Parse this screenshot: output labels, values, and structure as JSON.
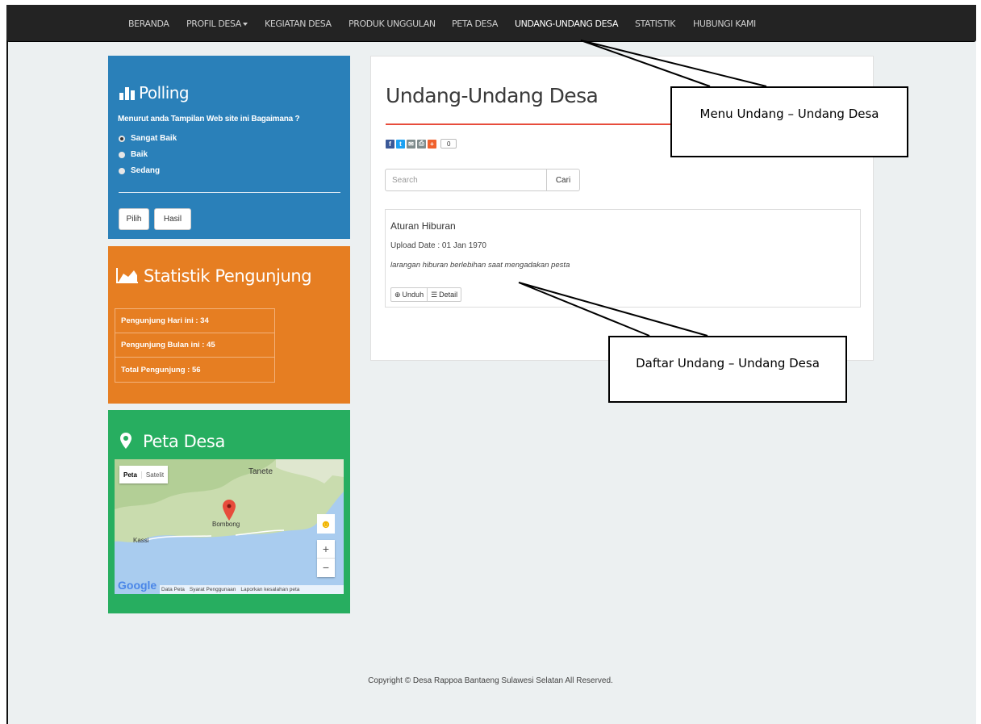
{
  "nav": {
    "items": [
      "BERANDA",
      "PROFIL DESA",
      "KEGIATAN DESA",
      "PRODUK UNGGULAN",
      "PETA DESA",
      "UNDANG-UNDANG DESA",
      "STATISTIK",
      "HUBUNGI KAMI"
    ]
  },
  "polling": {
    "title": "Polling",
    "question": "Menurut anda Tampilan Web site ini Bagaimana ?",
    "options": [
      "Sangat Baik",
      "Baik",
      "Sedang"
    ],
    "selected": "Sangat Baik",
    "vote_button": "Pilih",
    "result_button": "Hasil"
  },
  "stats": {
    "title": "Statistik Pengunjung",
    "rows": [
      "Pengunjung Hari ini : 34",
      "Pengunjung Bulan ini : 45",
      "Total Pengunjung : 56"
    ]
  },
  "map": {
    "title": "Peta Desa",
    "tab_map": "Peta",
    "tab_satellite": "Satelit",
    "places": [
      "Tanete",
      "Bombong",
      "Kassi"
    ],
    "logo": "Google",
    "footer_links": [
      "Data Peta",
      "Syarat Penggunaan",
      "Laporkan kesalahan peta"
    ]
  },
  "main": {
    "title": "Undang-Undang Desa",
    "share_count": "0",
    "search_placeholder": "Search",
    "search_button": "Cari",
    "document": {
      "title": "Aturan Hiburan",
      "upload_date": "Upload Date : 01 Jan 1970",
      "description": "larangan hiburan berlebihan saat mengadakan pesta",
      "download_button": "Unduh",
      "detail_button": "Detail"
    }
  },
  "footer": {
    "copyright": "Copyright © Desa Rappoa Bantaeng Sulawesi Selatan All Reserved."
  },
  "callouts": {
    "menu": "Menu Undang – Undang Desa",
    "list": "Daftar Undang – Undang Desa"
  }
}
